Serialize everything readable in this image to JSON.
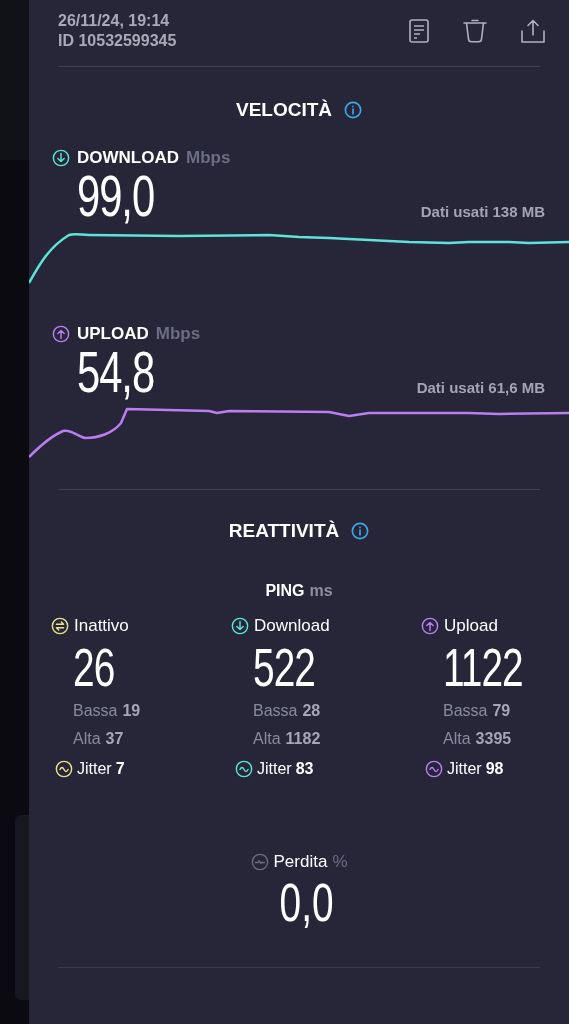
{
  "header": {
    "date": "26/11/24, 19:14",
    "id": "ID 10532599345"
  },
  "speed": {
    "title": "VELOCITÀ",
    "metrics": [
      {
        "kind": "download",
        "label": "DOWNLOAD",
        "unit": "Mbps",
        "value": "99,0",
        "data_used": "Dati usati 138 MB"
      },
      {
        "kind": "upload",
        "label": "UPLOAD",
        "unit": "Mbps",
        "value": "54,8",
        "data_used": "Dati usati 61,6 MB"
      }
    ]
  },
  "responsiveness": {
    "title": "REATTIVITÀ",
    "ping_label": "PING",
    "ping_unit": "ms",
    "columns": [
      {
        "kind": "idle",
        "label": "Inattivo",
        "value": "26",
        "low_label": "Bassa",
        "low": "19",
        "high_label": "Alta",
        "high": "37",
        "jitter_label": "Jitter",
        "jitter": "7"
      },
      {
        "kind": "download",
        "label": "Download",
        "value": "522",
        "low_label": "Bassa",
        "low": "28",
        "high_label": "Alta",
        "high": "1182",
        "jitter_label": "Jitter",
        "jitter": "83"
      },
      {
        "kind": "upload",
        "label": "Upload",
        "value": "1122",
        "low_label": "Bassa",
        "low": "79",
        "high_label": "Alta",
        "high": "3395",
        "jitter_label": "Jitter",
        "jitter": "98"
      }
    ],
    "loss": {
      "label": "Perdita",
      "unit": "%",
      "value": "0,0"
    }
  }
}
